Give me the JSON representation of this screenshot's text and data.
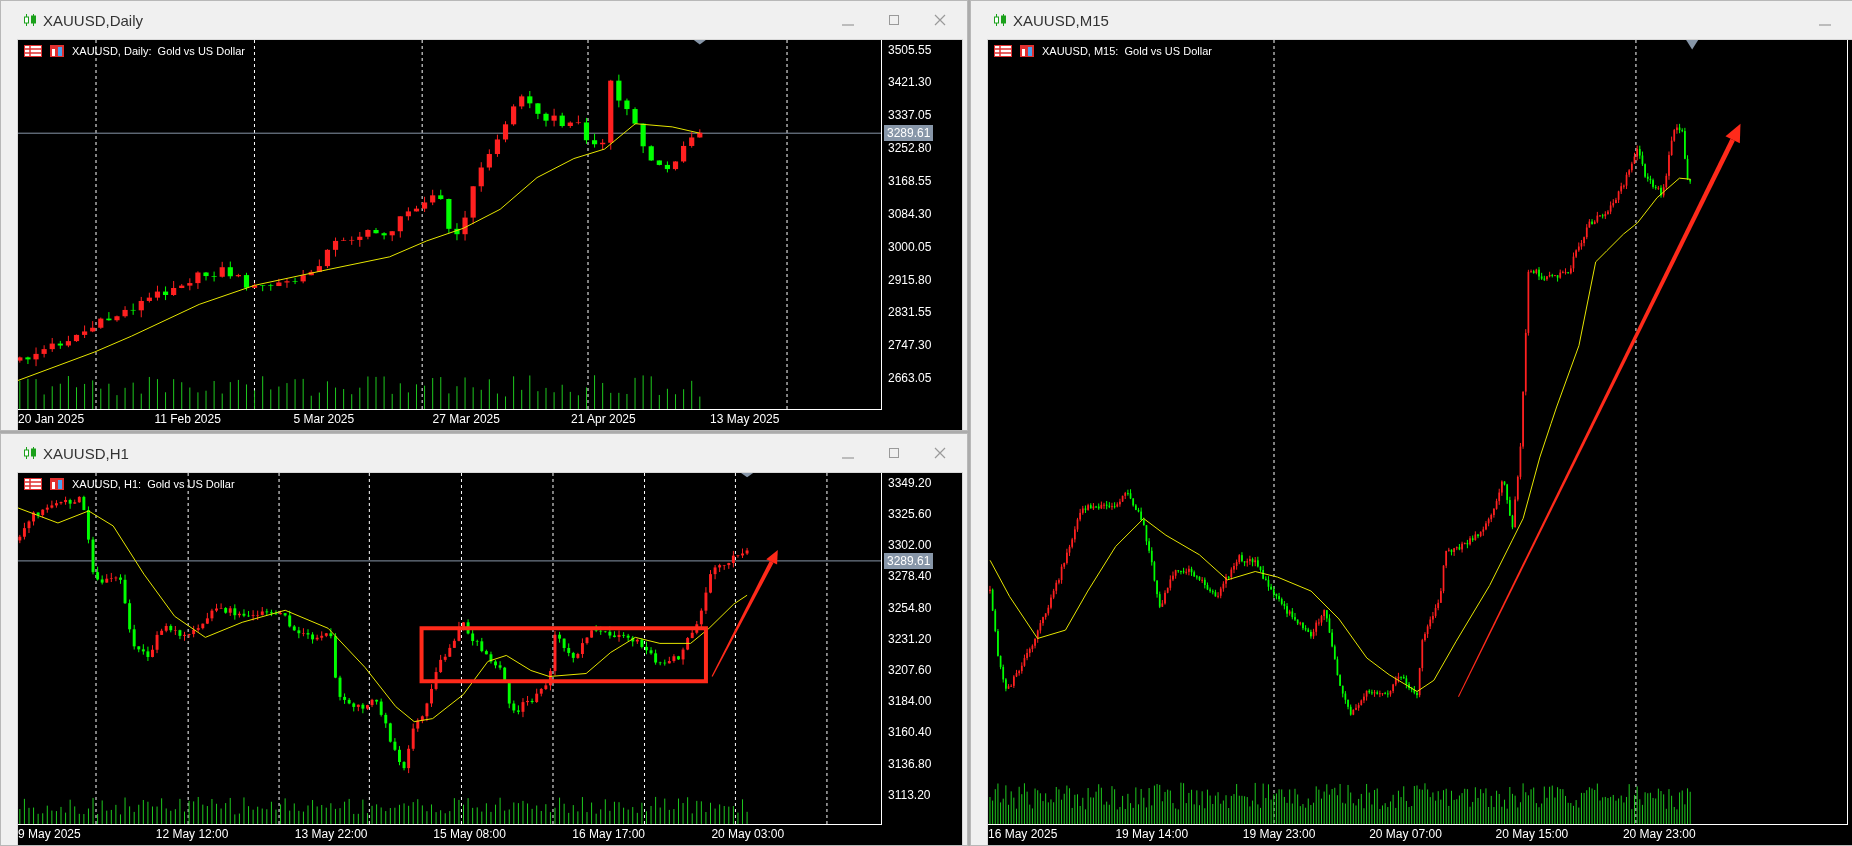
{
  "windows": [
    {
      "title": "XAUUSD,Daily",
      "chart_label": "XAUUSD, Daily:  Gold vs US Dollar",
      "price_scale": [
        "3505.55",
        "3421.30",
        "3337.05",
        "3252.80",
        "3168.55",
        "3084.30",
        "3000.05",
        "2915.80",
        "2831.55",
        "2747.30",
        "2663.05"
      ],
      "current_price": "3289.61",
      "time_scale": [
        "20 Jan 2025",
        "11 Feb 2025",
        "5 Mar 2025",
        "27 Mar 2025",
        "21 Apr 2025",
        "13 May 2025"
      ]
    },
    {
      "title": "XAUUSD,H1",
      "chart_label": "XAUUSD, H1:  Gold vs US Dollar",
      "price_scale": [
        "3349.20",
        "3325.60",
        "3302.00",
        "3278.40",
        "3254.80",
        "3231.20",
        "3207.60",
        "3184.00",
        "3160.40",
        "3136.80",
        "3113.20"
      ],
      "current_price": "3289.61",
      "time_scale": [
        "9 May 2025",
        "12 May 12:00",
        "13 May 22:00",
        "15 May 08:00",
        "16 May 17:00",
        "20 May 03:00"
      ],
      "markups": [
        {
          "kind": "box"
        },
        {
          "kind": "arrow"
        }
      ]
    },
    {
      "title": "XAUUSD,M15",
      "chart_label": "XAUUSD, M15:  Gold vs US Dollar",
      "time_scale": [
        "16 May 2025",
        "19 May 14:00",
        "19 May 23:00",
        "20 May 07:00",
        "20 May 15:00",
        "20 May 23:00"
      ],
      "markups": [
        {
          "kind": "arrow"
        }
      ]
    }
  ]
}
